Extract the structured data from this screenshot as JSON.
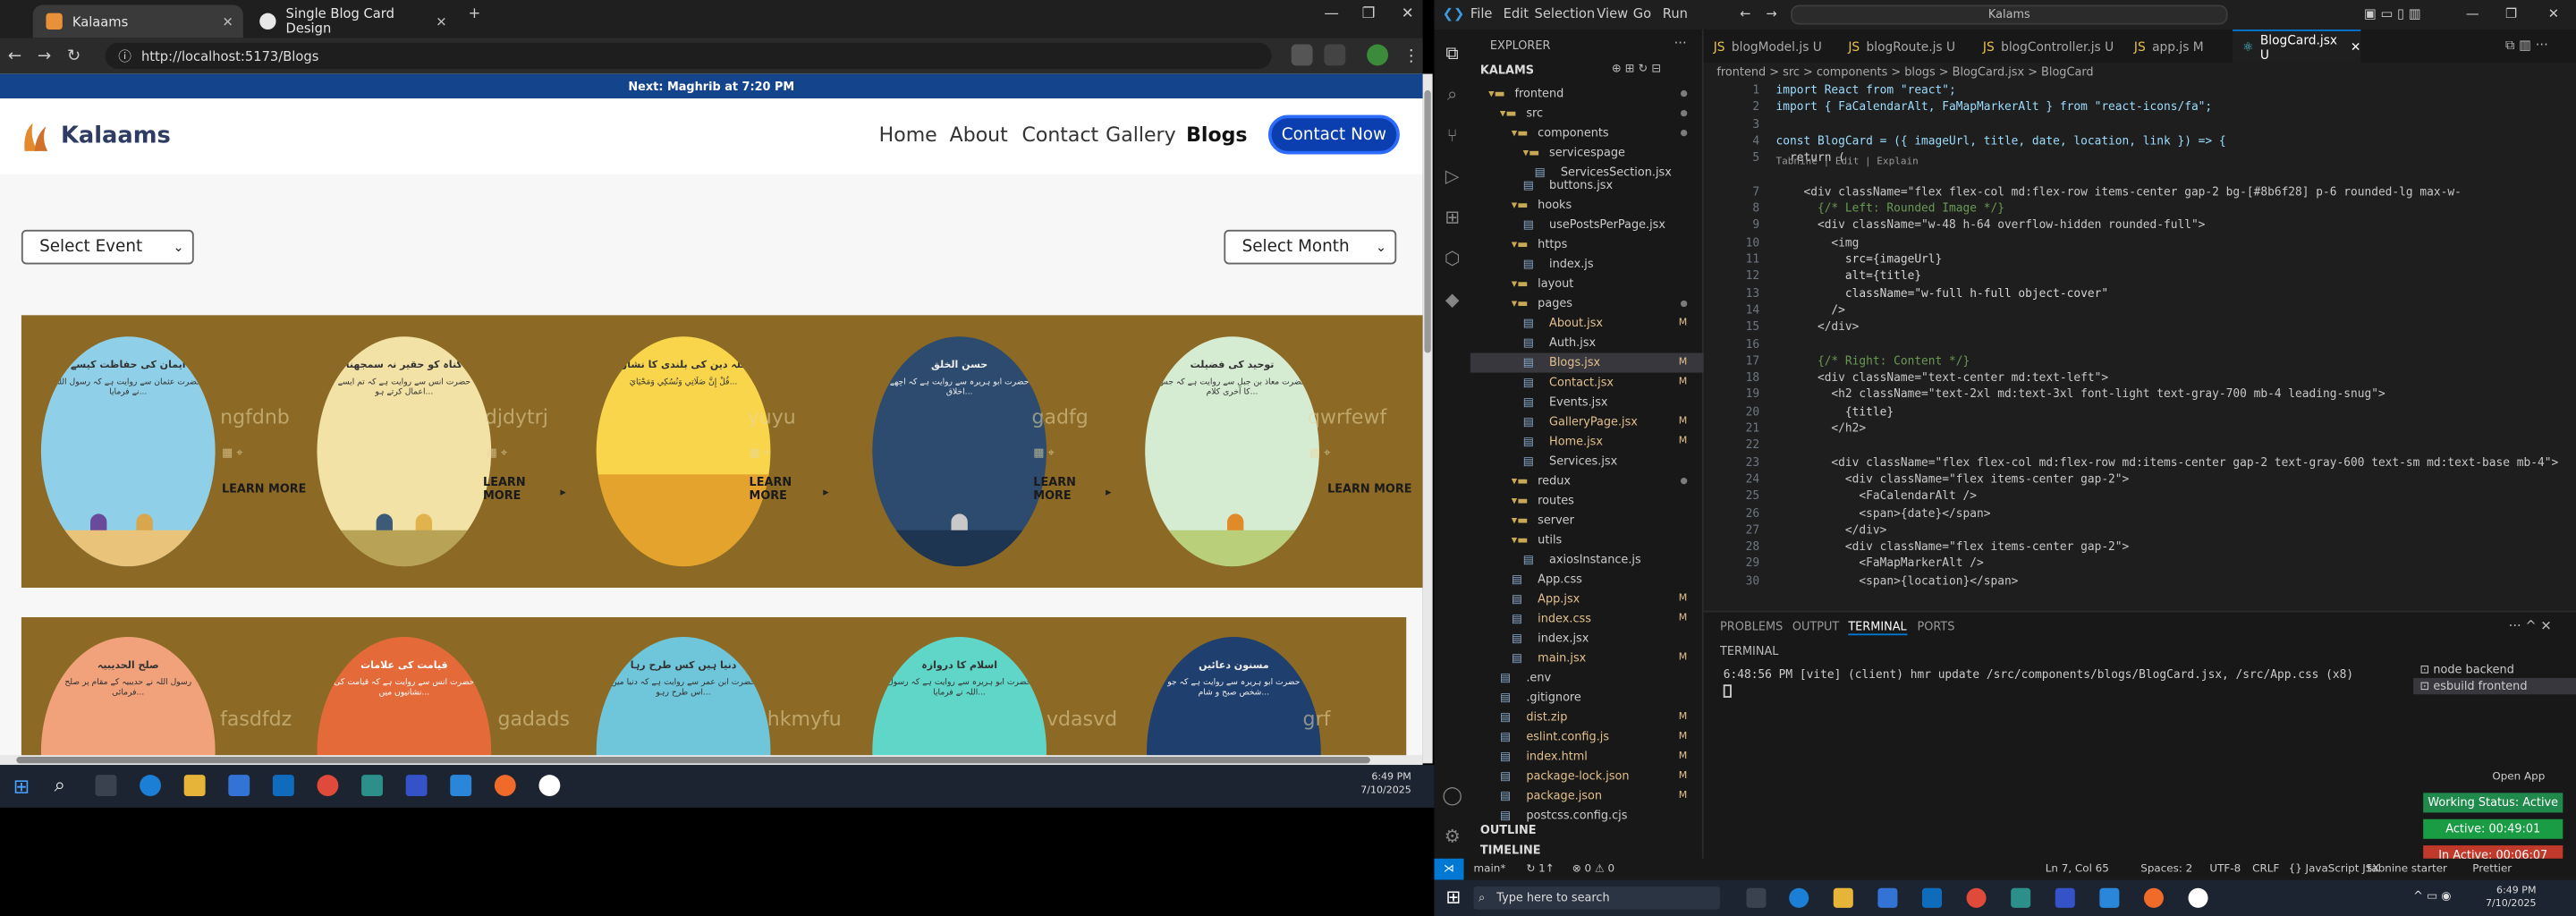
{
  "browser": {
    "tabs": [
      {
        "title": "Kalaams",
        "active": true
      },
      {
        "title": "Single Blog Card Design",
        "active": false
      }
    ],
    "url": "http://localhost:5173/Blogs"
  },
  "site": {
    "notice": "Next: Maghrib at 7:20 PM",
    "logo_text": "Kalaams",
    "nav": [
      "Home",
      "About",
      "Contact",
      "Gallery",
      "Blogs"
    ],
    "cta": "Contact Now",
    "select_event": "Select Event",
    "select_month": "Select Month",
    "row1": [
      {
        "title": "ایمان کی حفاظت کیسے",
        "label": "ngfdnb",
        "learn": "LEARN MORE"
      },
      {
        "title": "گناہ کو حقیر نہ سمجھنا",
        "label": "djdytrj",
        "learn": "LEARN MORE"
      },
      {
        "title": "اللہ دین کی بلندی کا نشان",
        "label": "yuyu",
        "learn": "LEARN MORE"
      },
      {
        "title": "حسن الخلق",
        "label": "gadfg",
        "learn": "LEARN MORE"
      },
      {
        "title": "توحید کی فضیلت",
        "label": "qwrfewf",
        "learn": "LEARN MORE"
      }
    ],
    "row2": [
      {
        "title": "صلح الحدیبیہ",
        "label": "fasdfdz"
      },
      {
        "title": "قیامت کی علامات",
        "label": "gadads"
      },
      {
        "title": "دنیا ہیں کس طرح رہا",
        "label": "hkmyfu"
      },
      {
        "title": "اسلام کا دروازہ",
        "label": "vdasvd"
      },
      {
        "title": "مسنون دعائیں",
        "label": "grf"
      }
    ]
  },
  "taskbar_left": {
    "time": "6:49 PM",
    "date": "7/10/2025"
  },
  "vscode": {
    "menu": [
      "File",
      "Edit",
      "Selection",
      "View",
      "Go",
      "Run"
    ],
    "search": "Kalams",
    "explorer_title": "EXPLORER",
    "workspace": "KALAMS",
    "tree": [
      {
        "name": "frontend",
        "indent": 1,
        "folder": true,
        "mark": "dot"
      },
      {
        "name": "src",
        "indent": 2,
        "folder": true,
        "mark": "dot"
      },
      {
        "name": "components",
        "indent": 3,
        "folder": true,
        "mark": "dot"
      },
      {
        "name": "servicespage",
        "indent": 4,
        "folder": true,
        "mark": ""
      },
      {
        "name": "ServicesSection.jsx",
        "indent": 5,
        "folder": false,
        "mark": ""
      },
      {
        "name": "buttons.jsx",
        "indent": 4,
        "folder": false,
        "mark": ""
      },
      {
        "name": "hooks",
        "indent": 3,
        "folder": true,
        "mark": ""
      },
      {
        "name": "usePostsPerPage.jsx",
        "indent": 4,
        "folder": false,
        "mark": ""
      },
      {
        "name": "https",
        "indent": 3,
        "folder": true,
        "mark": ""
      },
      {
        "name": "index.js",
        "indent": 4,
        "folder": false,
        "mark": ""
      },
      {
        "name": "layout",
        "indent": 3,
        "folder": true,
        "mark": ""
      },
      {
        "name": "pages",
        "indent": 3,
        "folder": true,
        "mark": "dot"
      },
      {
        "name": "About.jsx",
        "indent": 4,
        "folder": false,
        "mark": "M"
      },
      {
        "name": "Auth.jsx",
        "indent": 4,
        "folder": false,
        "mark": ""
      },
      {
        "name": "Blogs.jsx",
        "indent": 4,
        "folder": false,
        "mark": "M",
        "selected": true
      },
      {
        "name": "Contact.jsx",
        "indent": 4,
        "folder": false,
        "mark": "M"
      },
      {
        "name": "Events.jsx",
        "indent": 4,
        "folder": false,
        "mark": ""
      },
      {
        "name": "GalleryPage.jsx",
        "indent": 4,
        "folder": false,
        "mark": "M"
      },
      {
        "name": "Home.jsx",
        "indent": 4,
        "folder": false,
        "mark": "M"
      },
      {
        "name": "Services.jsx",
        "indent": 4,
        "folder": false,
        "mark": ""
      },
      {
        "name": "redux",
        "indent": 3,
        "folder": true,
        "mark": "dot"
      },
      {
        "name": "routes",
        "indent": 3,
        "folder": true,
        "mark": ""
      },
      {
        "name": "server",
        "indent": 3,
        "folder": true,
        "mark": ""
      },
      {
        "name": "utils",
        "indent": 3,
        "folder": true,
        "mark": ""
      },
      {
        "name": "axiosInstance.js",
        "indent": 4,
        "folder": false,
        "mark": ""
      },
      {
        "name": "App.css",
        "indent": 3,
        "folder": false,
        "mark": ""
      },
      {
        "name": "App.jsx",
        "indent": 3,
        "folder": false,
        "mark": "M"
      },
      {
        "name": "index.css",
        "indent": 3,
        "folder": false,
        "mark": "M"
      },
      {
        "name": "index.jsx",
        "indent": 3,
        "folder": false,
        "mark": ""
      },
      {
        "name": "main.jsx",
        "indent": 3,
        "folder": false,
        "mark": "M"
      },
      {
        "name": ".env",
        "indent": 2,
        "folder": false,
        "mark": ""
      },
      {
        "name": ".gitignore",
        "indent": 2,
        "folder": false,
        "mark": ""
      },
      {
        "name": "dist.zip",
        "indent": 2,
        "folder": false,
        "mark": "M"
      },
      {
        "name": "eslint.config.js",
        "indent": 2,
        "folder": false,
        "mark": "M"
      },
      {
        "name": "index.html",
        "indent": 2,
        "folder": false,
        "mark": "M"
      },
      {
        "name": "package-lock.json",
        "indent": 2,
        "folder": false,
        "mark": "M"
      },
      {
        "name": "package.json",
        "indent": 2,
        "folder": false,
        "mark": "M"
      },
      {
        "name": "postcss.config.cjs",
        "indent": 2,
        "folder": false,
        "mark": ""
      }
    ],
    "outline": "OUTLINE",
    "timeline": "TIMELINE",
    "editor_tabs": [
      "blogModel.js U",
      "blogRoute.js U",
      "blogController.js U",
      "app.js M",
      "BlogCard.jsx U"
    ],
    "breadcrumb": "frontend > src > components > blogs > BlogCard.jsx > BlogCard",
    "code_lines": [
      {
        "n": "1",
        "t": "import React from \"react\";"
      },
      {
        "n": "2",
        "t": "import { FaCalendarAlt, FaMapMarkerAlt } from \"react-icons/fa\";"
      },
      {
        "n": "3",
        "t": ""
      },
      {
        "n": "4",
        "t": "const BlogCard = ({ imageUrl, title, date, location, link }) => {"
      },
      {
        "n": "5",
        "t": "  return ("
      },
      {
        "n": "7",
        "t": "    <div className=\"flex flex-col md:flex-row items-center gap-2 bg-[#8b6f28] p-6 rounded-lg max-w-"
      },
      {
        "n": "8",
        "t": "      {/* Left: Rounded Image */}"
      },
      {
        "n": "9",
        "t": "      <div className=\"w-48 h-64 overflow-hidden rounded-full\">"
      },
      {
        "n": "10",
        "t": "        <img"
      },
      {
        "n": "11",
        "t": "          src={imageUrl}"
      },
      {
        "n": "12",
        "t": "          alt={title}"
      },
      {
        "n": "13",
        "t": "          className=\"w-full h-full object-cover\""
      },
      {
        "n": "14",
        "t": "        />"
      },
      {
        "n": "15",
        "t": "      </div>"
      },
      {
        "n": "16",
        "t": ""
      },
      {
        "n": "17",
        "t": "      {/* Right: Content */}"
      },
      {
        "n": "18",
        "t": "      <div className=\"text-center md:text-left\">"
      },
      {
        "n": "19",
        "t": "        <h2 className=\"text-2xl md:text-3xl font-light text-gray-700 mb-4 leading-snug\">"
      },
      {
        "n": "20",
        "t": "          {title}"
      },
      {
        "n": "21",
        "t": "        </h2>"
      },
      {
        "n": "22",
        "t": ""
      },
      {
        "n": "23",
        "t": "        <div className=\"flex flex-col md:flex-row md:items-center gap-2 text-gray-600 text-sm md:text-base mb-4\">"
      },
      {
        "n": "24",
        "t": "          <div className=\"flex items-center gap-2\">"
      },
      {
        "n": "25",
        "t": "            <FaCalendarAlt />"
      },
      {
        "n": "26",
        "t": "            <span>{date}</span>"
      },
      {
        "n": "27",
        "t": "          </div>"
      },
      {
        "n": "28",
        "t": "          <div className=\"flex items-center gap-2\">"
      },
      {
        "n": "29",
        "t": "            <FaMapMarkerAlt />"
      },
      {
        "n": "30",
        "t": "            <span>{location}</span>"
      }
    ],
    "codelens": "Tabnine | Edit | Explain",
    "panel_tabs": [
      "PROBLEMS",
      "OUTPUT",
      "TERMINAL",
      "PORTS"
    ],
    "terminal_header": "TERMINAL",
    "terminal_line": "6:48:56 PM [vite] (client) hmr update /src/components/blogs/BlogCard.jsx, /src/App.css (x8)",
    "terminals": [
      "node backend",
      "esbuild frontend"
    ],
    "open_app": "Open App",
    "working_status": "Working Status: Active",
    "active_time": "Active: 00:49:01",
    "inactive_time": "In Active: 00:06:07",
    "status_left": [
      "main*",
      "↻ 1↑",
      "⊗ 0 ⚠ 0"
    ],
    "status_right": [
      "Ln 7, Col 65",
      "Spaces: 2",
      "UTF-8",
      "CRLF",
      "{} JavaScript JSX",
      "tabnine starter",
      "Prettier"
    ]
  },
  "taskbar_right": {
    "search": "Type here to search",
    "time": "6:49 PM",
    "date": "7/10/2025"
  }
}
